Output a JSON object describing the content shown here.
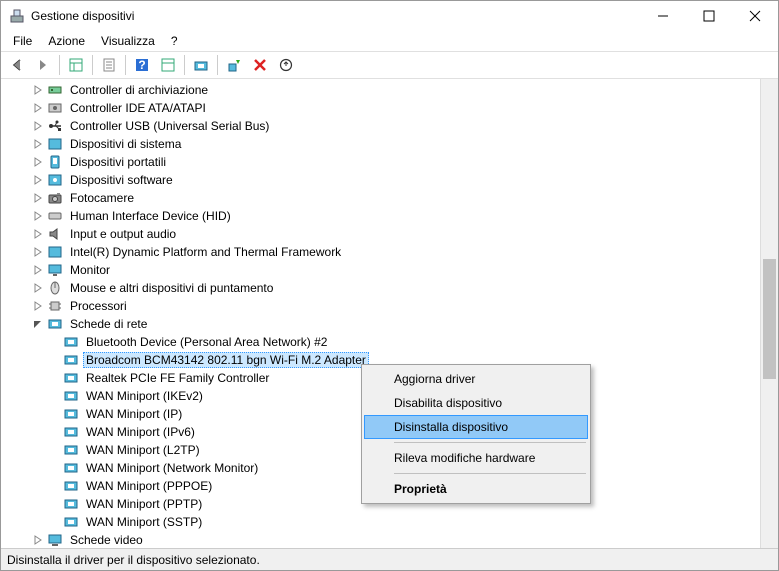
{
  "window": {
    "title": "Gestione dispositivi"
  },
  "menu": {
    "file": "File",
    "action": "Azione",
    "view": "Visualizza",
    "help": "?"
  },
  "tree": {
    "items": [
      {
        "label": "Controller di archiviazione",
        "icon": "controller",
        "expanded": false,
        "level": 1
      },
      {
        "label": "Controller IDE ATA/ATAPI",
        "icon": "ide",
        "expanded": false,
        "level": 1
      },
      {
        "label": "Controller USB (Universal Serial Bus)",
        "icon": "usb",
        "expanded": false,
        "level": 1
      },
      {
        "label": "Dispositivi di sistema",
        "icon": "system",
        "expanded": false,
        "level": 1
      },
      {
        "label": "Dispositivi portatili",
        "icon": "portable",
        "expanded": false,
        "level": 1
      },
      {
        "label": "Dispositivi software",
        "icon": "software",
        "expanded": false,
        "level": 1
      },
      {
        "label": "Fotocamere",
        "icon": "camera",
        "expanded": false,
        "level": 1
      },
      {
        "label": "Human Interface Device (HID)",
        "icon": "hid",
        "expanded": false,
        "level": 1
      },
      {
        "label": "Input e output audio",
        "icon": "audio",
        "expanded": false,
        "level": 1
      },
      {
        "label": "Intel(R) Dynamic Platform and Thermal Framework",
        "icon": "system",
        "expanded": false,
        "level": 1
      },
      {
        "label": "Monitor",
        "icon": "monitor",
        "expanded": false,
        "level": 1
      },
      {
        "label": "Mouse e altri dispositivi di puntamento",
        "icon": "mouse",
        "expanded": false,
        "level": 1
      },
      {
        "label": "Processori",
        "icon": "cpu",
        "expanded": false,
        "level": 1
      },
      {
        "label": "Schede di rete",
        "icon": "net",
        "expanded": true,
        "level": 1
      },
      {
        "label": "Bluetooth Device (Personal Area Network) #2",
        "icon": "net",
        "level": 2
      },
      {
        "label": "Broadcom BCM43142 802.11 bgn Wi-Fi M.2 Adapter",
        "icon": "net",
        "level": 2,
        "selected": true
      },
      {
        "label": "Realtek PCIe FE Family Controller",
        "icon": "net",
        "level": 2
      },
      {
        "label": "WAN Miniport (IKEv2)",
        "icon": "net",
        "level": 2
      },
      {
        "label": "WAN Miniport (IP)",
        "icon": "net",
        "level": 2
      },
      {
        "label": "WAN Miniport (IPv6)",
        "icon": "net",
        "level": 2
      },
      {
        "label": "WAN Miniport (L2TP)",
        "icon": "net",
        "level": 2
      },
      {
        "label": "WAN Miniport (Network Monitor)",
        "icon": "net",
        "level": 2
      },
      {
        "label": "WAN Miniport (PPPOE)",
        "icon": "net",
        "level": 2
      },
      {
        "label": "WAN Miniport (PPTP)",
        "icon": "net",
        "level": 2
      },
      {
        "label": "WAN Miniport (SSTP)",
        "icon": "net",
        "level": 2
      },
      {
        "label": "Schede video",
        "icon": "display",
        "expanded": false,
        "level": 1
      }
    ]
  },
  "context_menu": {
    "update": "Aggiorna driver",
    "disable": "Disabilita dispositivo",
    "uninstall": "Disinstalla dispositivo",
    "scan": "Rileva modifiche hardware",
    "properties": "Proprietà"
  },
  "status": {
    "text": "Disinstalla il driver per il dispositivo selezionato."
  }
}
